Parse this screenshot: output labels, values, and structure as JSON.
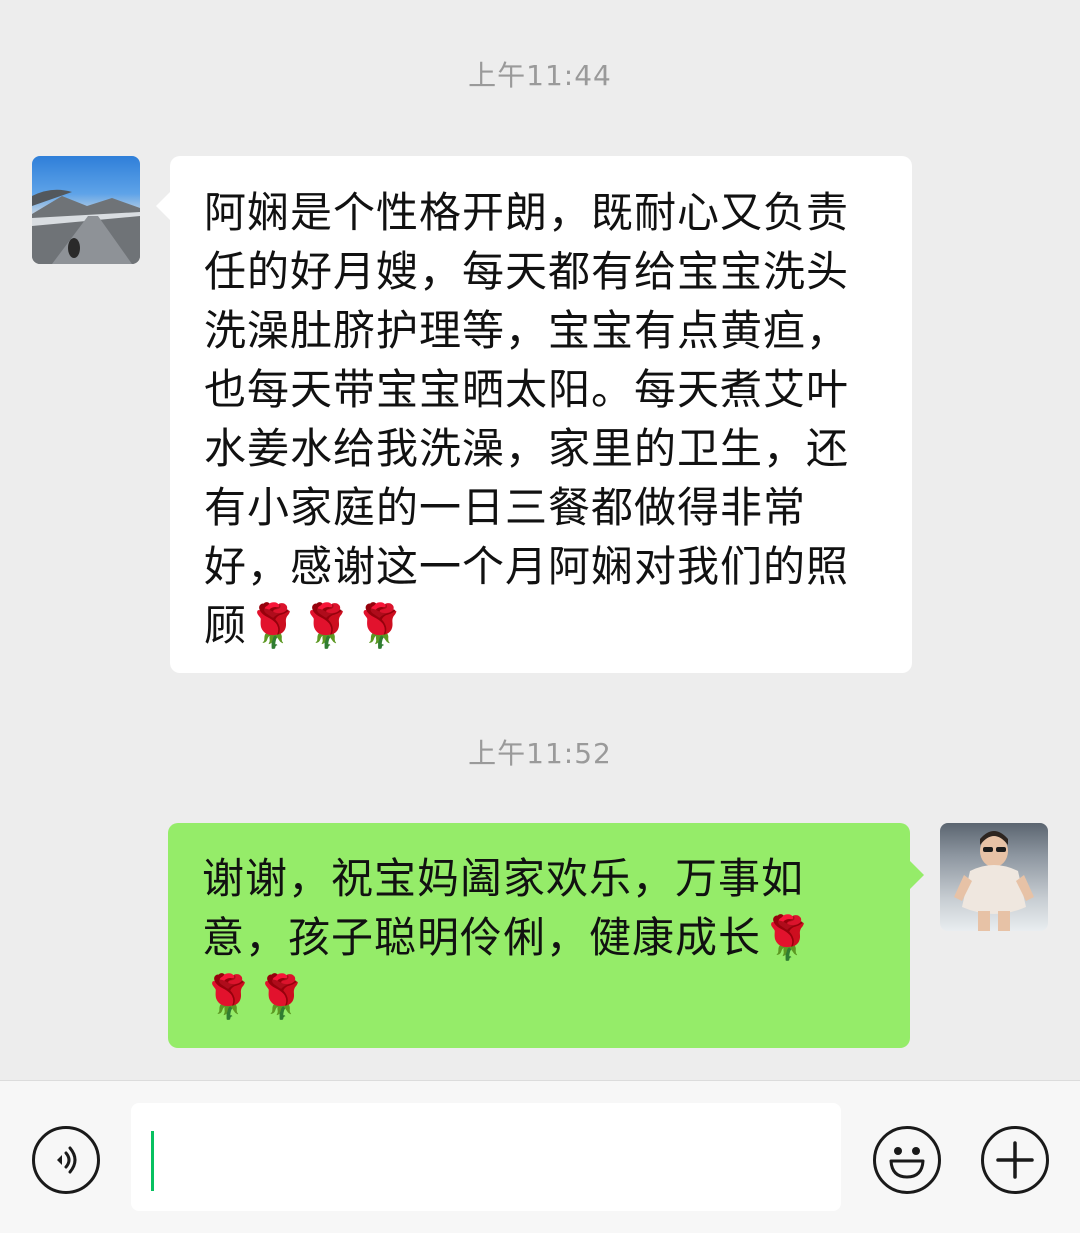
{
  "chat": {
    "messages": [
      {
        "timestamp": "上午11:44",
        "sender": "other",
        "text": "阿娴是个性格开朗，既耐心又负责\n任的好月嫂，每天都有给宝宝洗头\n洗澡肚脐护理等，宝宝有点黄疸，\n也每天带宝宝晒太阳。每天煮艾叶\n水姜水给我洗澡，家里的卫生，还\n有小家庭的一日三餐都做得非常\n好，感谢这一个月阿娴对我们的照\n顾🌹🌹🌹"
      },
      {
        "timestamp": "上午11:52",
        "sender": "me",
        "text": "谢谢，祝宝妈阖家欢乐，万事如\n意，孩子聪明伶俐，健康成长🌹\n🌹🌹"
      }
    ]
  },
  "input_bar": {
    "icons": {
      "voice": "voice-icon",
      "emoji": "emoji-icon",
      "plus": "plus-icon"
    },
    "input_value": "",
    "cursor_color": "#07c160"
  },
  "colors": {
    "chat_background": "#ededed",
    "my_bubble": "#95ec69",
    "other_bubble": "#ffffff"
  }
}
